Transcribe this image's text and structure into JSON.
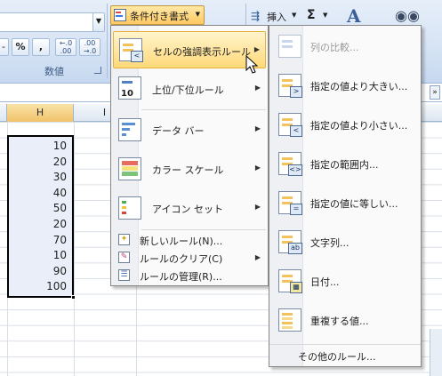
{
  "ribbon": {
    "cond_format_label": "条件付き書式",
    "insert_label": "挿入",
    "sigma_symbol": "Σ",
    "number_group_label": "数値",
    "percent_symbol": "%",
    "comma_symbol": ",",
    "inc_decimal": "←.0 .00",
    "dec_decimal": ".00 →.0"
  },
  "sheet": {
    "columns": [
      "H",
      "I"
    ],
    "values": [
      "10",
      "20",
      "30",
      "40",
      "50",
      "20",
      "70",
      "10",
      "90",
      "100"
    ]
  },
  "menu": {
    "items": [
      {
        "label": "セルの強調表示ルール",
        "submenu": true,
        "highlighted": true,
        "icon": "highlight-cells-icon"
      },
      {
        "label": "上位/下位ルール",
        "submenu": true,
        "icon": "top-bottom-icon"
      },
      {
        "label": "データ バー",
        "submenu": true,
        "icon": "data-bar-icon"
      },
      {
        "label": "カラー スケール",
        "submenu": true,
        "icon": "color-scale-icon"
      },
      {
        "label": "アイコン セット",
        "submenu": true,
        "icon": "icon-set-icon"
      },
      {
        "label": "新しいルール(N)...",
        "submenu": false,
        "icon": "new-rule-icon"
      },
      {
        "label": "ルールのクリア(C)",
        "submenu": true,
        "icon": "clear-rules-icon"
      },
      {
        "label": "ルールの管理(R)...",
        "submenu": false,
        "icon": "manage-rules-icon"
      }
    ]
  },
  "submenu": {
    "items": [
      {
        "label": "列の比較...",
        "disabled": true,
        "badge": ""
      },
      {
        "label": "指定の値より大きい...",
        "badge": ">"
      },
      {
        "label": "指定の値より小さい...",
        "badge": "<"
      },
      {
        "label": "指定の範囲内...",
        "badge": "<>"
      },
      {
        "label": "指定の値に等しい...",
        "badge": "="
      },
      {
        "label": "文字列...",
        "badge": "ab"
      },
      {
        "label": "日付...",
        "badge": "▦"
      },
      {
        "label": "重複する値...",
        "badge": ""
      }
    ],
    "more_rules": "その他のルール..."
  },
  "colors": {
    "highlight": "#ffd979",
    "selection_fill": "#e9eef8",
    "ribbon_bg": "#d7e4f5"
  }
}
